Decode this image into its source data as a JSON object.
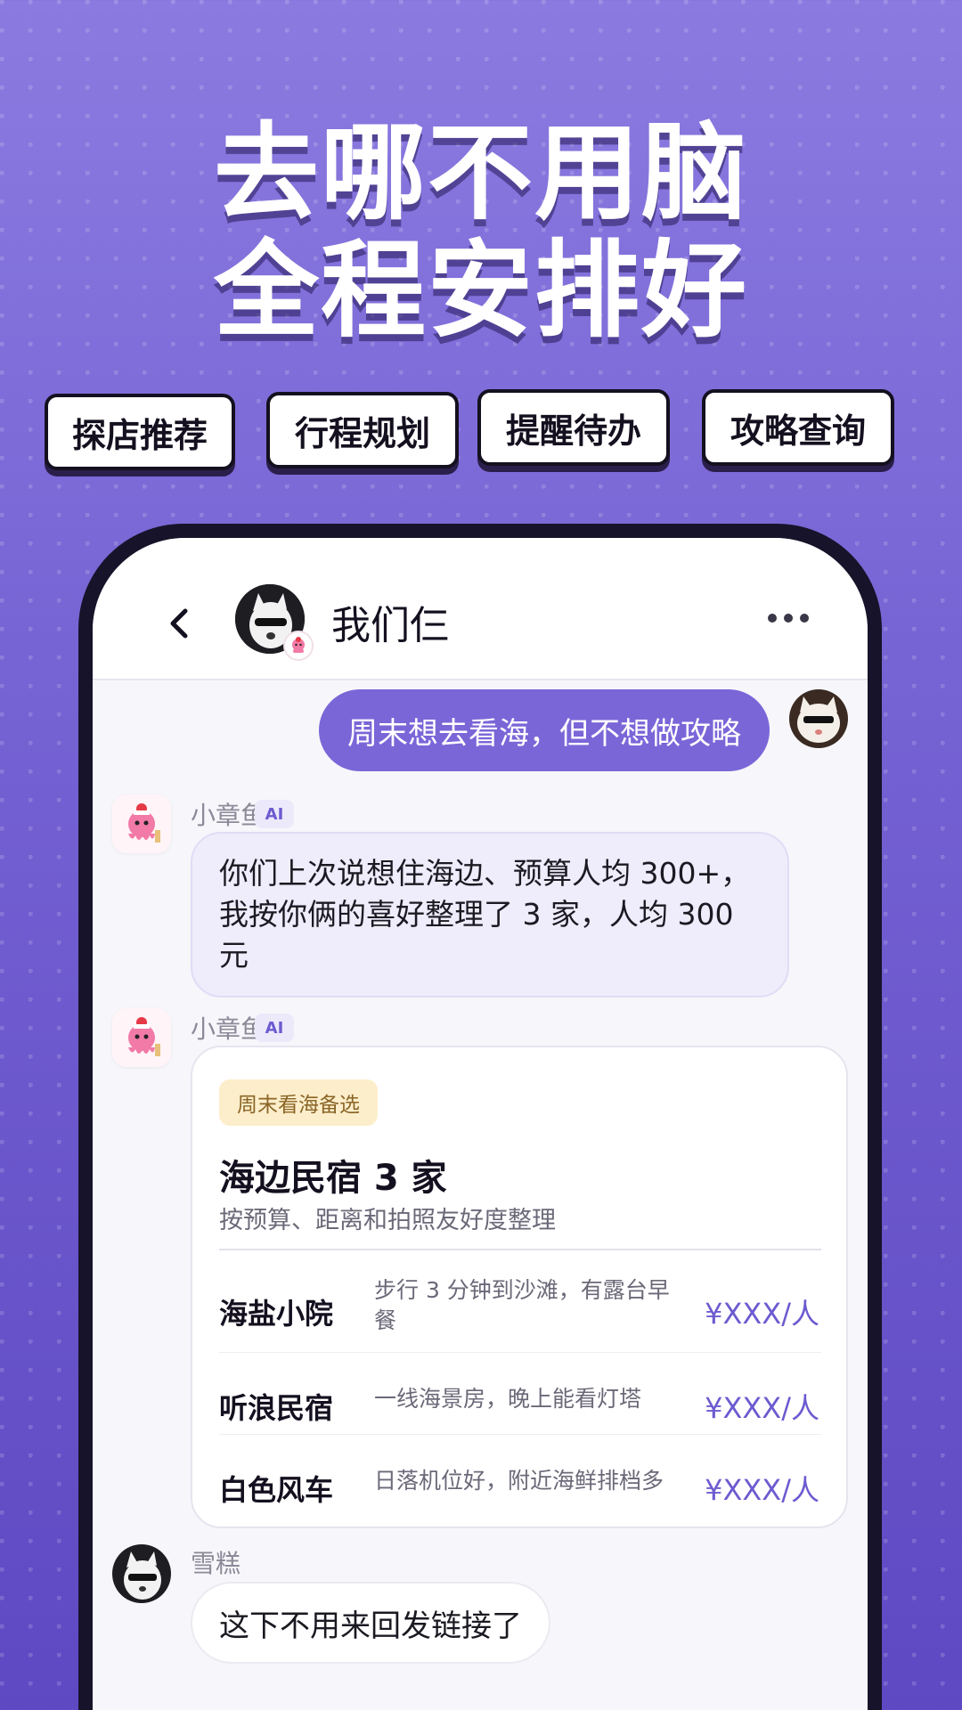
{
  "hero": {
    "line1": "去哪不用脑",
    "line2": "全程安排好"
  },
  "tags": [
    "探店推荐",
    "行程规划",
    "提醒待办",
    "攻略查询"
  ],
  "chat": {
    "title": "我们仨",
    "icons": {
      "back": "back-chevron-icon",
      "more": "more-dots-icon"
    },
    "messages": {
      "user_message": "周末想去看海，但不想做攻略",
      "bot_name": "小章鱼",
      "ai_badge": "AI",
      "bot_text": "你们上次说想住海边、预算人均 300+，我按你俩的喜好整理了 3 家，人均 300 元",
      "bot_name_2": "小章鱼",
      "ai_badge_2": "AI",
      "friend_name": "雪糕",
      "friend_text": "这下不用来回发链接了"
    },
    "card": {
      "tag": "周末看海备选",
      "title": "海边民宿 3 家",
      "subtitle": "按预算、距离和拍照友好度整理",
      "items": [
        {
          "name": "海盐小院",
          "desc": "步行 3 分钟到沙滩，有露台早餐",
          "price": "¥XXX/人"
        },
        {
          "name": "听浪民宿",
          "desc": "一线海景房，晚上能看灯塔",
          "price": "¥XXX/人"
        },
        {
          "name": "白色风车",
          "desc": "日落机位好，附近海鲜排档多",
          "price": "¥XXX/人"
        }
      ]
    }
  },
  "colors": {
    "accent": "#7b66d8",
    "price": "#6c5bd0",
    "tag_bg": "#fdeecb"
  }
}
